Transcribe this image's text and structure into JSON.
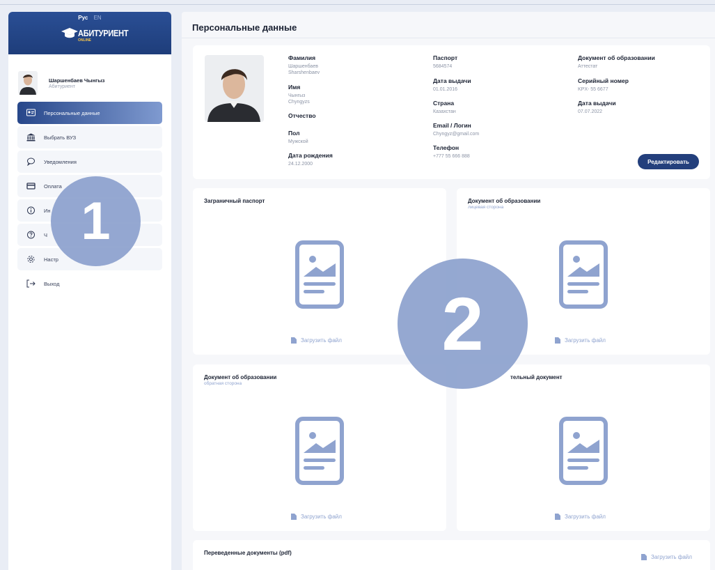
{
  "sidebar": {
    "lang_active": "Рус",
    "lang_other": "EN",
    "logo_text": "АБИТУРИЕНТ",
    "logo_sub": "ONLINE",
    "user_name": "Шаршенбаев Чынгыз",
    "user_role": "Абитуриент",
    "items": [
      {
        "label": "Персональные данные",
        "icon": "id-card-icon"
      },
      {
        "label": "Выбрать ВУЗ",
        "icon": "university-icon"
      },
      {
        "label": "Уведомления",
        "icon": "chat-bubble-icon"
      },
      {
        "label": "Оплата",
        "icon": "credit-card-icon"
      },
      {
        "label": "Ин",
        "icon": "info-icon"
      },
      {
        "label": "Ч",
        "icon": "question-icon"
      },
      {
        "label": "Настр",
        "icon": "gear-icon"
      },
      {
        "label": "Выход",
        "icon": "logout-icon"
      }
    ]
  },
  "main": {
    "title": "Персональные данные",
    "personal": {
      "surname_label": "Фамилия",
      "surname_value": "Шаршенбаев",
      "surname_value_lat": "Sharshenbaev",
      "name_label": "Имя",
      "name_value": "Чынгыз",
      "name_value_lat": "Chyngyzs",
      "patronymic_label": "Отчество",
      "gender_label": "Пол",
      "gender_value": "Мужской",
      "birth_label": "Дата рождения",
      "birth_value": "24.12.2000",
      "passport_label": "Паспорт",
      "passport_value": "5684574",
      "issue_label": "Дата выдачи",
      "issue_value": "01.01.2016",
      "country_label": "Страна",
      "country_value": "Казахстан",
      "email_label": "Email / Логин",
      "email_value": "Chyngyz@gmail.com",
      "phone_label": "Телефон",
      "phone_value": "+777 55 666 888",
      "edu_doc_label": "Документ об образовании",
      "edu_doc_value": "Аттестат",
      "serial_label": "Серийный номер",
      "serial_value": "KPX- 55 6677",
      "edu_issue_label": "Дата выдачи",
      "edu_issue_value": "07.07.2022",
      "edit_button": "Редактировать"
    },
    "documents": [
      {
        "title": "Заграничный паспорт",
        "subtitle": "",
        "upload": "Загрузить файл"
      },
      {
        "title": "Документ об образовании",
        "subtitle": "лицевая сторона",
        "upload": "Загрузить файл"
      },
      {
        "title": "Документ об образовании",
        "subtitle": "обратная сторона",
        "upload": "Загрузить файл"
      },
      {
        "title": "тельный документ",
        "subtitle": "",
        "upload": "Загрузить файл"
      }
    ],
    "translated": {
      "title": "Переведенные документы (pdf)",
      "upload": "Загрузить файл"
    }
  },
  "overlays": {
    "marker1": "1",
    "marker2": "2"
  },
  "colors": {
    "brand": "#233f7c",
    "accent_light": "#8fa3cf",
    "marker": "#8a9ecc"
  }
}
